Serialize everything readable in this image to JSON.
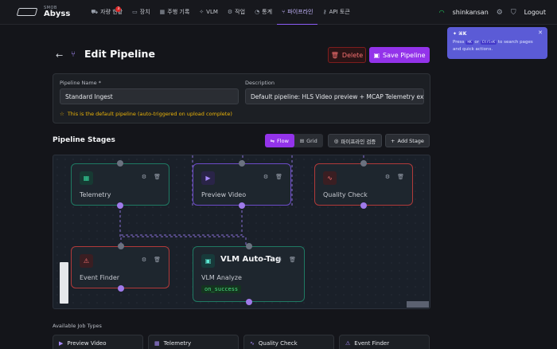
{
  "app": {
    "brand_sub": "SMOB",
    "brand_name": "Abyss"
  },
  "nav": {
    "items": [
      {
        "label": "자량 현황",
        "icon": "car-icon",
        "badge": "3"
      },
      {
        "label": "장치",
        "icon": "device-icon"
      },
      {
        "label": "주행 기록",
        "icon": "map-icon"
      },
      {
        "label": "VLM",
        "icon": "sparkle-icon"
      },
      {
        "label": "작업",
        "icon": "gear-icon"
      },
      {
        "label": "통계",
        "icon": "chart-icon"
      },
      {
        "label": "파이프라인",
        "icon": "pipeline-icon",
        "active": true
      },
      {
        "label": "API 토큰",
        "icon": "key-icon"
      }
    ],
    "username": "shinkansan",
    "logout": "Logout"
  },
  "toast": {
    "title": "⌘K",
    "body_pre": "Press",
    "key1": "⌘K",
    "or": "or",
    "key2": "Ctrl+K",
    "body_post": "to search pages and quick actions."
  },
  "header": {
    "title": "Edit Pipeline",
    "delete_label": "Delete",
    "save_label": "Save Pipeline"
  },
  "form": {
    "name_label": "Pipeline Name *",
    "name_value": "Standard Ingest",
    "desc_label": "Description",
    "desc_value": "Default pipeline: HLS Video preview + MCAP Telemetry ex",
    "default_note": "This is the default pipeline (auto-triggered on upload complete)"
  },
  "stages": {
    "title": "Pipeline Stages",
    "view_flow": "Flow",
    "view_grid": "Grid",
    "validate_label": "파이프라인 검증",
    "add_label": "Add Stage"
  },
  "nodes": {
    "telemetry": {
      "name": "Telemetry"
    },
    "preview": {
      "name": "Preview Video"
    },
    "quality": {
      "name": "Quality Check"
    },
    "event": {
      "name": "Event Finder"
    },
    "vlm": {
      "title": "VLM Auto-Tag",
      "subtitle": "VLM Analyze",
      "tag": "on_success"
    }
  },
  "jobs": {
    "title": "Available Job Types",
    "items": [
      "Preview Video",
      "Telemetry",
      "Quality Check",
      "Event Finder"
    ]
  },
  "colors": {
    "accent": "#9333ea",
    "danger": "#f87171",
    "success": "#4ade80"
  }
}
